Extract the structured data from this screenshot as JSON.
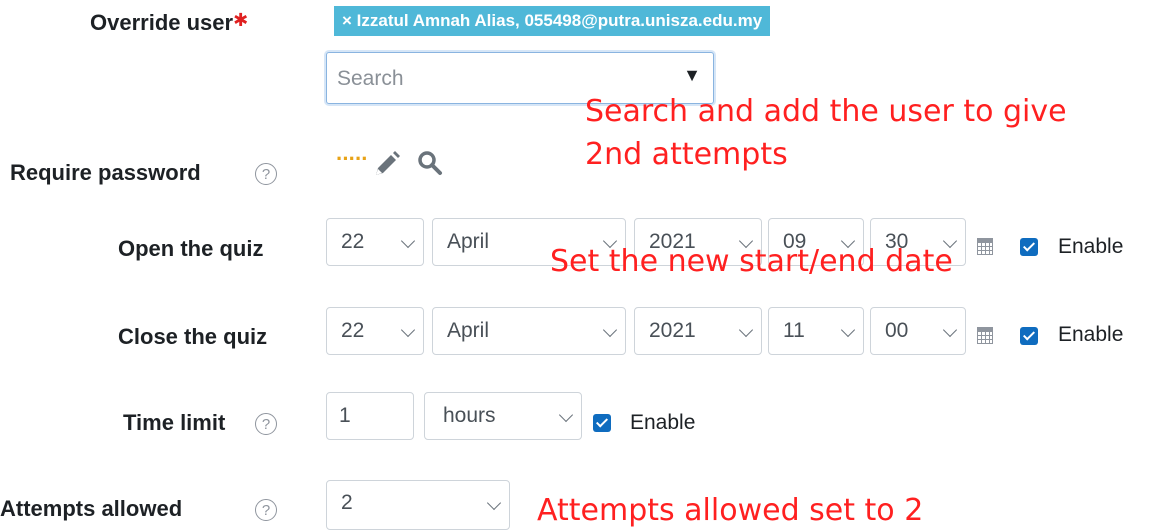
{
  "override_user": {
    "label": "Override user",
    "required_mark": "✱",
    "selected_tag": "× Izzatul Amnah Alias, 055498@putra.unisza.edu.my",
    "search_placeholder": "Search",
    "dropdown_arrow": "▼"
  },
  "require_password": {
    "label": "Require password",
    "help": "?",
    "masked_value": "·····"
  },
  "open_quiz": {
    "label": "Open the quiz",
    "day": "22",
    "month": "April",
    "year": "2021",
    "hour": "09",
    "minute": "30",
    "enable_label": "Enable",
    "enabled": true
  },
  "close_quiz": {
    "label": "Close the quiz",
    "day": "22",
    "month": "April",
    "year": "2021",
    "hour": "11",
    "minute": "00",
    "enable_label": "Enable",
    "enabled": true
  },
  "time_limit": {
    "label": "Time limit",
    "help": "?",
    "value": "1",
    "unit": "hours",
    "enable_label": "Enable",
    "enabled": true
  },
  "attempts": {
    "label": "Attempts allowed",
    "help": "?",
    "value": "2"
  },
  "annotations": {
    "search_note_line1": "Search and add the user to give",
    "search_note_line2": "2nd attempts",
    "date_note": "Set the new start/end date",
    "attempts_note": "Attempts allowed set to 2"
  },
  "colors": {
    "accent": "#0f6cbf",
    "tag_bg": "#4fb8d8",
    "annotation": "#ff2020",
    "required": "#e02020",
    "password_dots": "#e8a317"
  }
}
